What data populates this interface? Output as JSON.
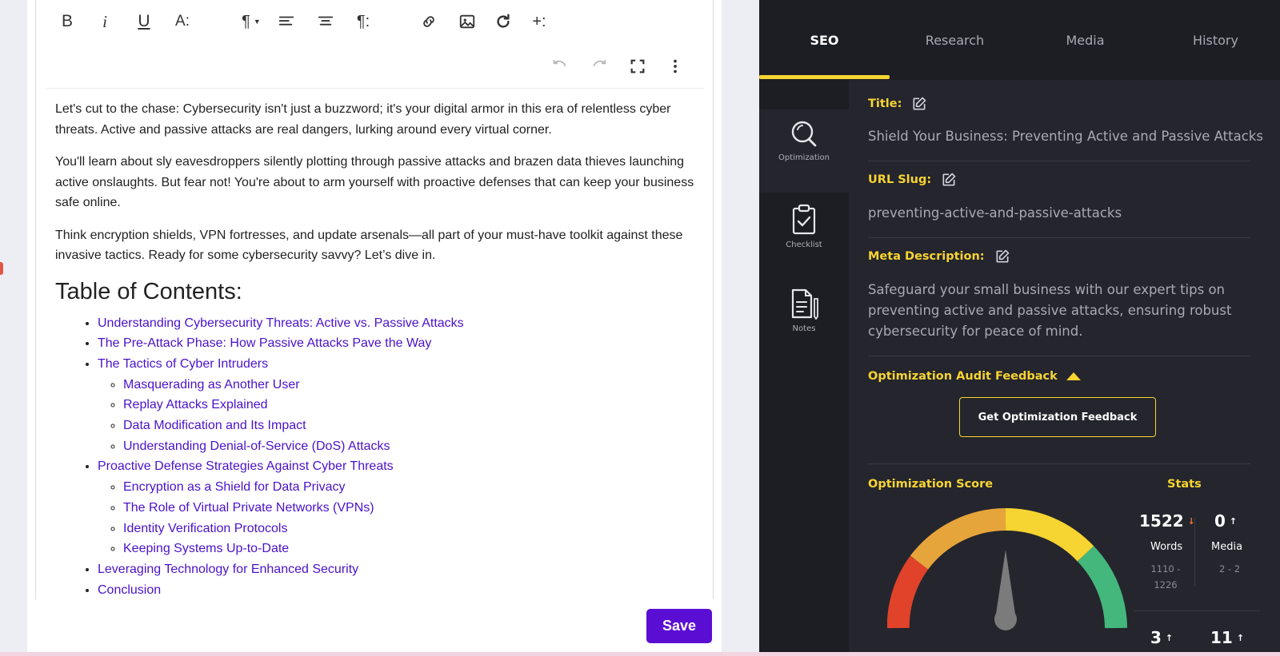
{
  "editor": {
    "toolbar": {
      "bold": "B",
      "italic": "i",
      "underline": "U",
      "text_size": "A:",
      "paragraph": "¶",
      "paragraph_more": "¶:",
      "insert_more": "+:"
    },
    "paragraphs": [
      "Let's cut to the chase: Cybersecurity isn't just a buzzword; it's your digital armor in this era of relentless cyber threats. Active and passive attacks are real dangers, lurking around every virtual corner.",
      "You'll learn about sly eavesdroppers silently plotting through passive attacks and brazen data thieves launching active onslaughts. But fear not! You're about to arm yourself with proactive defenses that can keep your business safe online.",
      "Think encryption shields, VPN fortresses, and update arsenals—all part of your must-have toolkit against these invasive tactics. Ready for some cybersecurity savvy? Let’s dive in."
    ],
    "toc_title": "Table of Contents:",
    "toc": [
      {
        "label": "Understanding Cybersecurity Threats: Active vs. Passive Attacks",
        "children": []
      },
      {
        "label": "The Pre-Attack Phase: How Passive Attacks Pave the Way",
        "children": []
      },
      {
        "label": "The Tactics of Cyber Intruders",
        "children": [
          "Masquerading as Another User",
          "Replay Attacks Explained",
          "Data Modification and Its Impact",
          "Understanding Denial-of-Service (DoS) Attacks"
        ]
      },
      {
        "label": "Proactive Defense Strategies Against Cyber Threats",
        "children": [
          "Encryption as a Shield for Data Privacy",
          "The Role of Virtual Private Networks (VPNs)",
          "Identity Verification Protocols",
          "Keeping Systems Up-to-Date"
        ]
      },
      {
        "label": "Leveraging Technology for Enhanced Security",
        "children": []
      },
      {
        "label": "Conclusion",
        "children": []
      }
    ],
    "save_label": "Save"
  },
  "panel": {
    "tabs": [
      {
        "label": "SEO",
        "active": true
      },
      {
        "label": "Research",
        "active": false
      },
      {
        "label": "Media",
        "active": false
      },
      {
        "label": "History",
        "active": false
      }
    ],
    "rail": [
      {
        "label": "Optimization",
        "icon": "magnifier-icon",
        "active": true
      },
      {
        "label": "Checklist",
        "icon": "clipboard-check-icon",
        "active": false
      },
      {
        "label": "Notes",
        "icon": "notes-icon",
        "active": false
      }
    ],
    "title_label": "Title:",
    "title_value": "Shield Your Business: Preventing Active and Passive Attacks",
    "slug_label": "URL Slug:",
    "slug_value": "preventing-active-and-passive-attacks",
    "meta_label": "Meta Description:",
    "meta_value": "Safeguard your small business with our expert tips on preventing active and passive attacks, ensuring robust cybersecurity for peace of mind.",
    "audit_label": "Optimization Audit Feedback",
    "feedback_button": "Get Optimization Feedback",
    "score_label": "Optimization Score",
    "stats_label": "Stats",
    "stats": {
      "words_value": "1522",
      "words_arrow": "↓",
      "words_label": "Words",
      "words_range_1": "1110 -",
      "words_range_2": "1226",
      "media_value": "0",
      "media_arrow": "↑",
      "media_label": "Media",
      "media_range": "2 - 2",
      "row2_a_value": "3",
      "row2_a_arrow": "↑",
      "row2_b_value": "11",
      "row2_b_arrow": "↑"
    },
    "colors": {
      "accent": "#f6d431",
      "gauge_red": "#e0432a",
      "gauge_orange": "#e6a53b",
      "gauge_yellow": "#f6d431",
      "gauge_green": "#43b77c",
      "needle": "#7b7b7b",
      "words_arrow": "#e8763a"
    }
  }
}
